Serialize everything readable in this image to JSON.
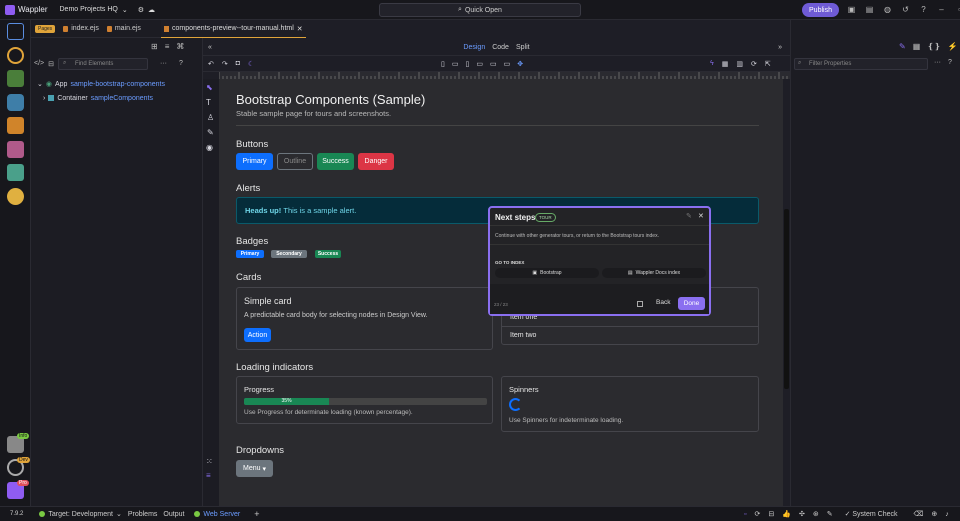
{
  "topbar": {
    "app_name": "Wappler",
    "project": "Demo Projects HQ",
    "quick_open": "Quick Open",
    "publish": "Publish"
  },
  "left_rail": {
    "badges": [
      "Info",
      "Dev",
      "Pro"
    ]
  },
  "pages_panel": {
    "pages_tag": "Pages",
    "tabs": [
      "index.ejs",
      "main.ejs",
      "components-preview--tour-manual.html"
    ],
    "find_placeholder": "Find Elements",
    "tree": [
      {
        "type": "App",
        "name": "sample-bootstrap-components"
      },
      {
        "type": "Container",
        "name": "sampleComponents"
      }
    ]
  },
  "designer": {
    "view_tabs": [
      "Design",
      "Code",
      "Split"
    ],
    "active_view": "Design"
  },
  "page": {
    "title": "Bootstrap Components (Sample)",
    "subtitle": "Stable sample page for tours and screenshots.",
    "buttons_heading": "Buttons",
    "buttons": [
      "Primary",
      "Outline",
      "Success",
      "Danger"
    ],
    "alerts_heading": "Alerts",
    "alert_strong": "Heads up!",
    "alert_text": "This is a sample alert.",
    "badges_heading": "Badges",
    "badges": [
      "Primary",
      "Secondary",
      "Success"
    ],
    "cards_heading": "Cards",
    "card_title": "Simple card",
    "card_text": "A predictable card body for selecting nodes in Design View.",
    "card_button": "Action",
    "list_items": [
      "Item one",
      "Item two"
    ],
    "loading_heading": "Loading indicators",
    "progress_title": "Progress",
    "progress_value": 35,
    "progress_label": "35%",
    "progress_help": "Use Progress for determinate loading (known percentage).",
    "spinners_title": "Spinners",
    "spinners_help": "Use Spinners for indeterminate loading.",
    "dropdowns_heading": "Dropdowns",
    "dropdown_button": "Menu"
  },
  "tour": {
    "title": "Next steps",
    "tag": "TOUR",
    "text": "Continue with other generator tours, or return to the Bootstrap tours index.",
    "section": "GO TO INDEX",
    "links": [
      "Bootstrap",
      "Wappler Docs index"
    ],
    "counter": "23 / 23",
    "back": "Back",
    "done": "Done"
  },
  "properties": {
    "filter_placeholder": "Filter Properties"
  },
  "statusbar": {
    "version": "7.9.2",
    "target": "Target: Development",
    "problems": "Problems",
    "output": "Output",
    "web_server": "Web Server",
    "system_check": "System Check"
  },
  "colors": {
    "accent": "#8a6ff0",
    "primary": "#0d6efd",
    "success": "#198754",
    "danger": "#dc3545",
    "alert_bg": "#052c3a"
  }
}
